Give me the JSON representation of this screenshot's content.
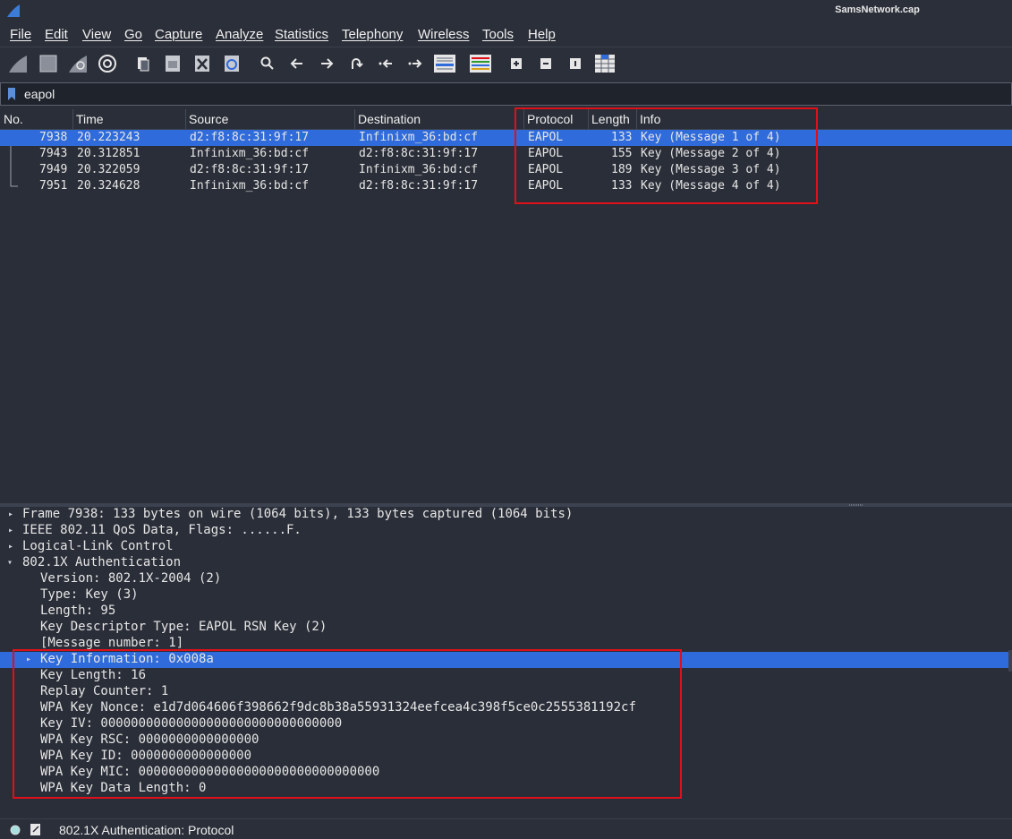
{
  "window": {
    "title": "SamsNetwork.cap"
  },
  "menu": [
    "File",
    "Edit",
    "View",
    "Go",
    "Capture",
    "Analyze",
    "Statistics",
    "Telephony",
    "Wireless",
    "Tools",
    "Help"
  ],
  "toolbar_icons": [
    "shark-fin-icon",
    "stop-icon",
    "restart-icon",
    "options-gear-icon",
    "open-file-icon",
    "save-file-icon",
    "close-file-icon",
    "reload-file-icon",
    "find-icon",
    "go-back-icon",
    "go-forward-icon",
    "go-to-packet-icon",
    "first-packet-icon",
    "last-packet-icon",
    "autoscroll-icon",
    "colorize-icon",
    "zoom-in-icon",
    "zoom-out-icon",
    "normal-size-icon",
    "resize-columns-icon"
  ],
  "filter": {
    "value": "eapol"
  },
  "packet_list": {
    "columns": [
      "No.",
      "Time",
      "Source",
      "Destination",
      "Protocol",
      "Length",
      "Info"
    ],
    "rows": [
      {
        "no": "7938",
        "time": "20.223243",
        "source": "d2:f8:8c:31:9f:17",
        "destination": "Infinixm_36:bd:cf",
        "protocol": "EAPOL",
        "length": "133",
        "info": "Key (Message 1 of 4)"
      },
      {
        "no": "7943",
        "time": "20.312851",
        "source": "Infinixm_36:bd:cf",
        "destination": "d2:f8:8c:31:9f:17",
        "protocol": "EAPOL",
        "length": "155",
        "info": "Key (Message 2 of 4)"
      },
      {
        "no": "7949",
        "time": "20.322059",
        "source": "d2:f8:8c:31:9f:17",
        "destination": "Infinixm_36:bd:cf",
        "protocol": "EAPOL",
        "length": "189",
        "info": "Key (Message 3 of 4)"
      },
      {
        "no": "7951",
        "time": "20.324628",
        "source": "Infinixm_36:bd:cf",
        "destination": "d2:f8:8c:31:9f:17",
        "protocol": "EAPOL",
        "length": "133",
        "info": "Key (Message 4 of 4)"
      }
    ]
  },
  "details": {
    "top": [
      "Frame 7938: 133 bytes on wire (1064 bits), 133 bytes captured (1064 bits)",
      "IEEE 802.11 QoS Data, Flags: ......F.",
      "Logical-Link Control",
      "802.1X Authentication"
    ],
    "auth": [
      "Version: 802.1X-2004 (2)",
      "Type: Key (3)",
      "Length: 95",
      "Key Descriptor Type: EAPOL RSN Key (2)",
      "[Message number: 1]",
      "Key Information: 0x008a",
      "Key Length: 16",
      "Replay Counter: 1",
      "WPA Key Nonce: e1d7d064606f398662f9dc8b38a55931324eefcea4c398f5ce0c2555381192cf",
      "Key IV: 00000000000000000000000000000000",
      "WPA Key RSC: 0000000000000000",
      "WPA Key ID: 0000000000000000",
      "WPA Key MIC: 00000000000000000000000000000000",
      "WPA Key Data Length: 0"
    ]
  },
  "status": {
    "text": "802.1X Authentication: Protocol"
  },
  "colors": {
    "selection": "#2f6bda",
    "highlight_box": "#e0101a",
    "background": "#2a2e38"
  }
}
